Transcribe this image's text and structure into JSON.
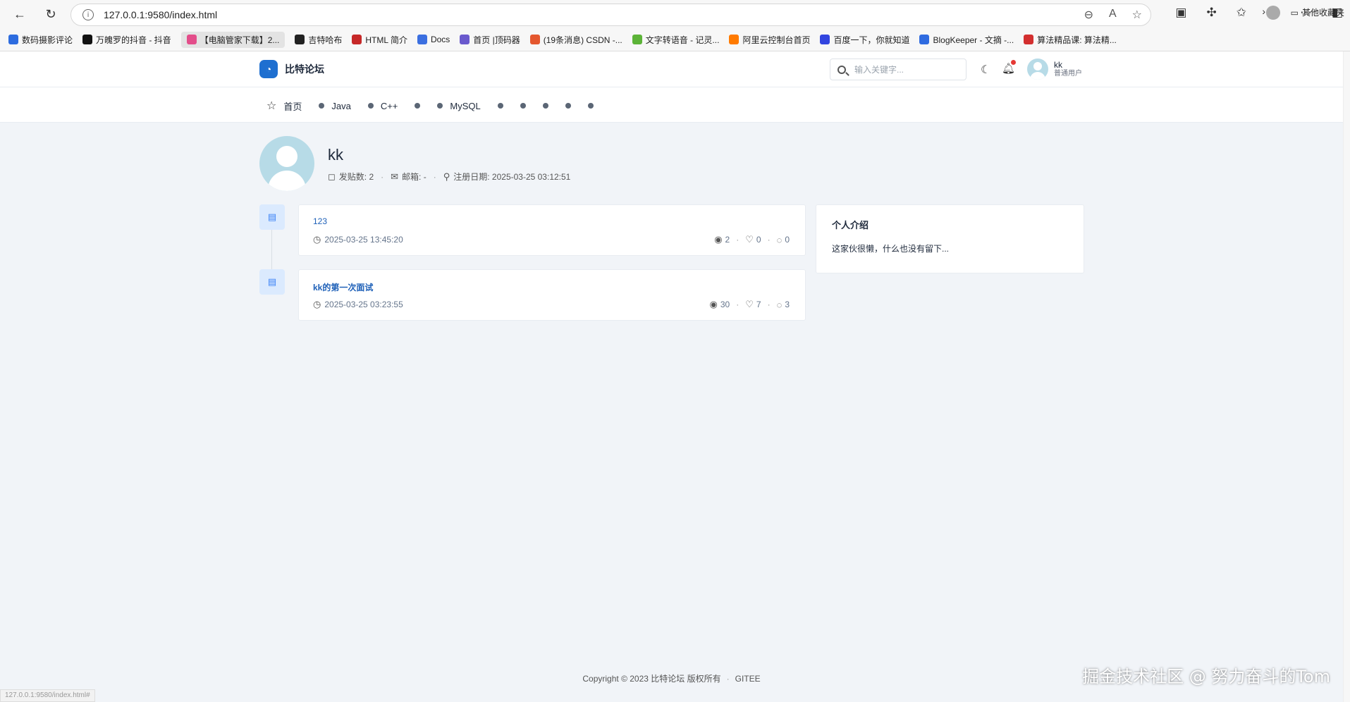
{
  "browser": {
    "url": "127.0.0.1:9580/index.html",
    "bookmarks": [
      {
        "label": "数码摄影评论",
        "color": "#2d6cdf"
      },
      {
        "label": "万魄罗的抖音 - 抖音",
        "color": "#111111"
      },
      {
        "label": "【电脑管家下载】2...",
        "color": "#e34d8a"
      },
      {
        "label": "吉特哈布",
        "color": "#222222"
      },
      {
        "label": "HTML 简介",
        "color": "#c62828"
      },
      {
        "label": "Docs",
        "color": "#3b6fe0"
      },
      {
        "label": "首页 |顶码器",
        "color": "#6a5acd"
      },
      {
        "label": "(19条消息) CSDN -...",
        "color": "#e4572e"
      },
      {
        "label": "文字转语音 - 记灵...",
        "color": "#5cb338"
      },
      {
        "label": "阿里云控制台首页",
        "color": "#ff7a00"
      },
      {
        "label": "百度一下，你就知道",
        "color": "#3245df"
      },
      {
        "label": "BlogKeeper - 文摘 -...",
        "color": "#2f6be0"
      },
      {
        "label": "算法精品课: 算法精...",
        "color": "#d32f2f"
      }
    ],
    "other_bookmarks": "其他收藏夹",
    "status_url": "127.0.0.1:9580/index.html#"
  },
  "header": {
    "site_name": "比特论坛",
    "search_placeholder": "输入关键字...",
    "user_name": "kk",
    "user_role": "普通用户"
  },
  "nav": {
    "home": "首页",
    "items": [
      "Java",
      "C++",
      "",
      "MySQL",
      "",
      "",
      "",
      "",
      ""
    ]
  },
  "profile": {
    "name": "kk",
    "post_count_label": "发贴数: 2",
    "email_label": "邮箱: -",
    "register_label": "注册日期: 2025-03-25 03:12:51"
  },
  "posts": [
    {
      "title": "123",
      "time": "2025-03-25 13:45:20",
      "views": "2",
      "likes": "0",
      "comments": "0",
      "bold": false
    },
    {
      "title": "kk的第一次面试",
      "time": "2025-03-25 03:23:55",
      "views": "30",
      "likes": "7",
      "comments": "3",
      "bold": true
    }
  ],
  "intro": {
    "heading": "个人介绍",
    "text": "这家伙很懒，什么也没有留下..."
  },
  "footer": {
    "copyright": "Copyright © 2023 比特论坛 版权所有",
    "gitee": "GITEE"
  },
  "watermark": "掘金技术社区 @ 努力奋斗的Tom"
}
